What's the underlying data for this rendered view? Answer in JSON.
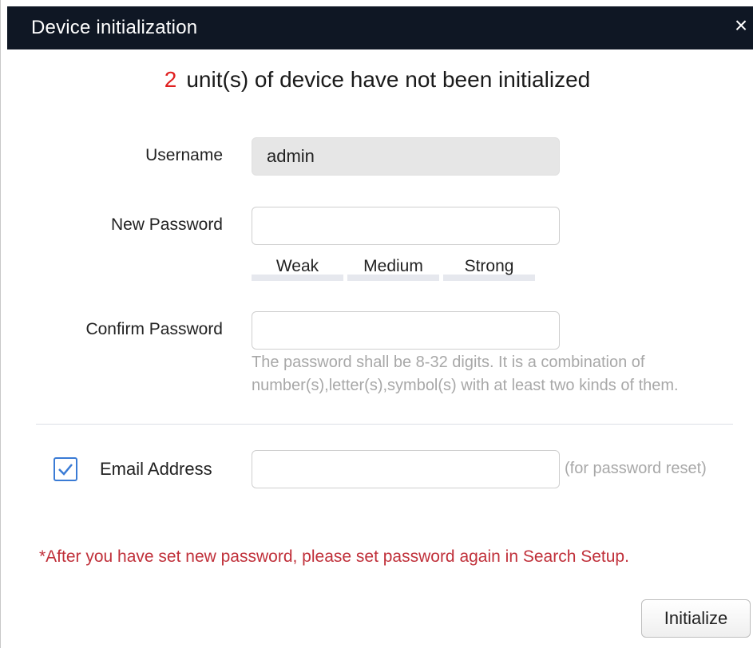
{
  "dialog": {
    "title": "Device initialization",
    "close_symbol": "×"
  },
  "headline": {
    "count": "2",
    "text": "unit(s) of device have not been initialized"
  },
  "form": {
    "username_label": "Username",
    "username_value": "admin",
    "new_password_label": "New Password",
    "new_password_value": "",
    "strength_levels": [
      "Weak",
      "Medium",
      "Strong"
    ],
    "confirm_password_label": "Confirm Password",
    "confirm_password_value": "",
    "password_hint": "The password shall be 8-32 digits. It is a combination of number(s),letter(s),symbol(s) with at least two kinds of them.",
    "email_checked": true,
    "email_label": "Email Address",
    "email_value": "",
    "email_note": "(for password reset)"
  },
  "warning": "*After you have set new password, please set password again in Search Setup.",
  "buttons": {
    "initialize_label": "Initialize"
  },
  "colors": {
    "titlebar": "#0f1724",
    "count": "#e02020",
    "warning": "#c0303a",
    "checkbox": "#3a7bd5",
    "hint": "#a8a8a8"
  },
  "icons": {
    "close": "close-icon",
    "check": "checkmark-icon"
  }
}
